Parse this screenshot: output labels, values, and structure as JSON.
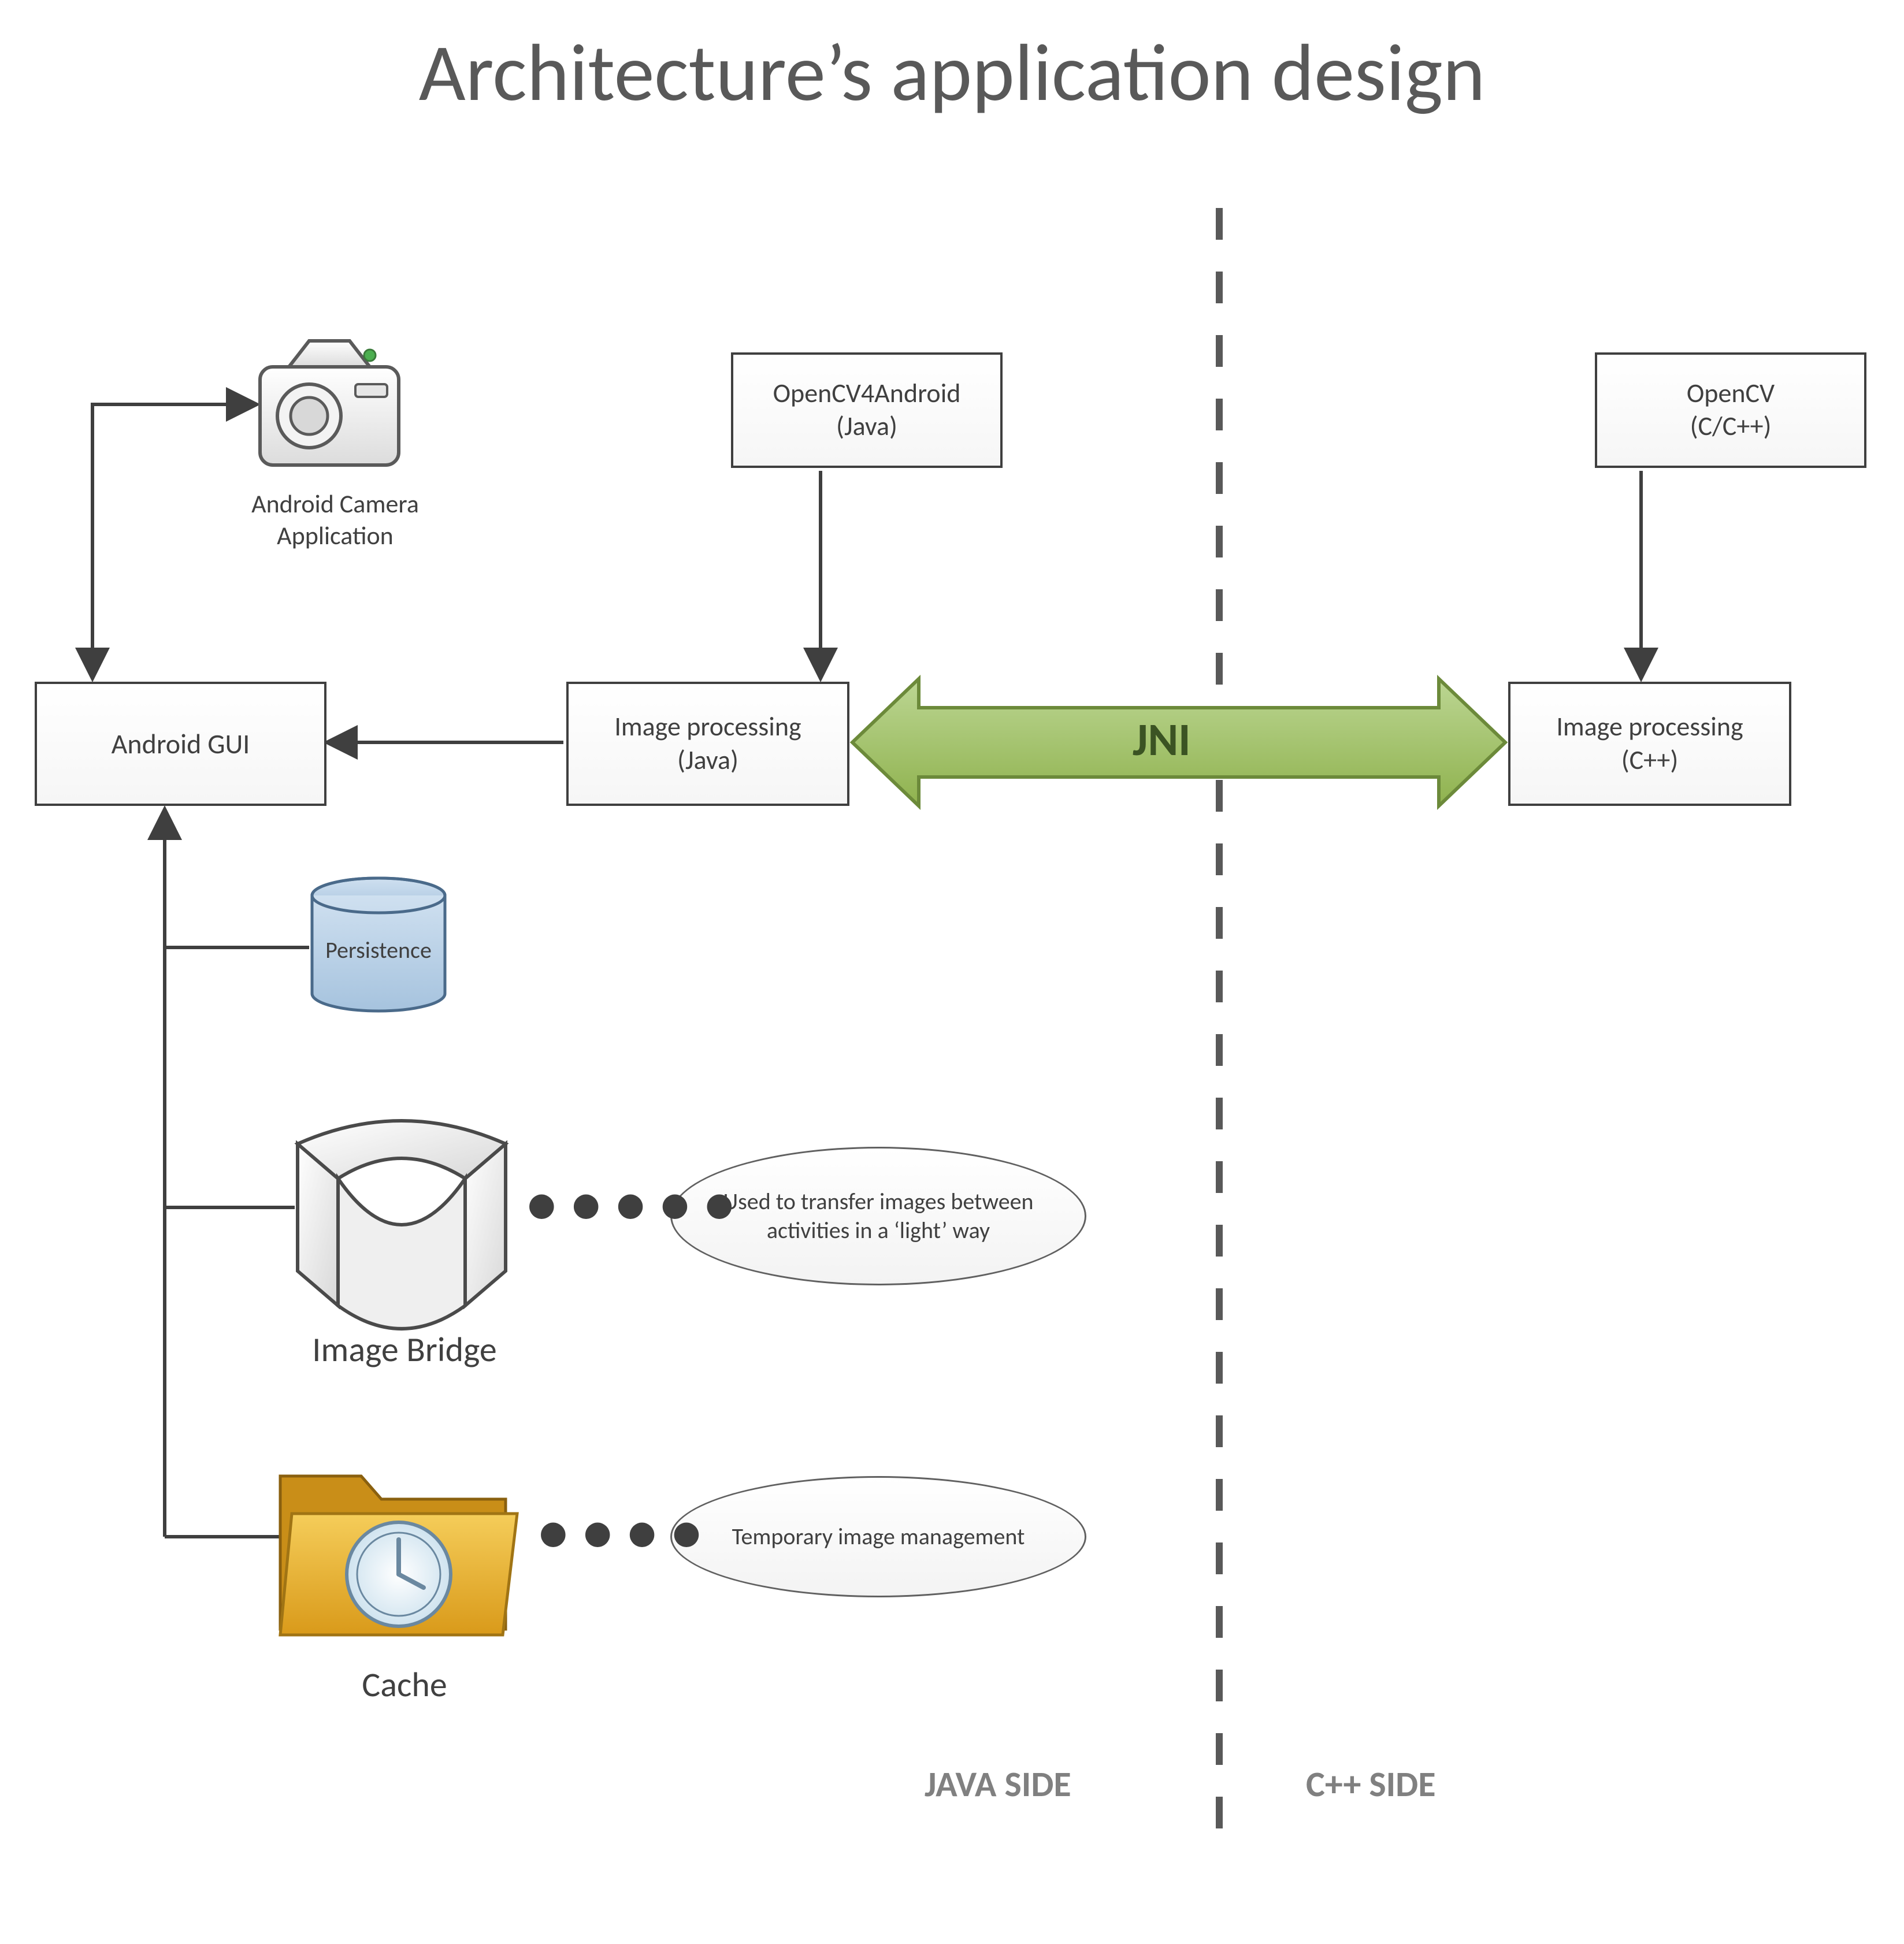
{
  "title": "Architecture’s application design",
  "boxes": {
    "opencv4android": "OpenCV4Android\n(Java)",
    "opencv_cpp": "OpenCV\n(C/C++)",
    "android_gui": "Android GUI",
    "img_proc_java": "Image processing\n(Java)",
    "img_proc_cpp": "Image processing\n(C++)"
  },
  "labels": {
    "camera": "Android Camera\nApplication",
    "image_bridge": "Image Bridge",
    "cache": "Cache",
    "persistence": "Persistence",
    "java_side": "JAVA SIDE",
    "cpp_side": "C++ SIDE",
    "jni": "JNI"
  },
  "notes": {
    "bridge_note": "Used to transfer images between activities in a ‘light’ way",
    "cache_note": "Temporary image management"
  },
  "colors": {
    "jni_fill": "#9bbb59",
    "jni_stroke": "#71893f",
    "db_fill": "#b8cde4",
    "folder_fill": "#e8b32a"
  }
}
